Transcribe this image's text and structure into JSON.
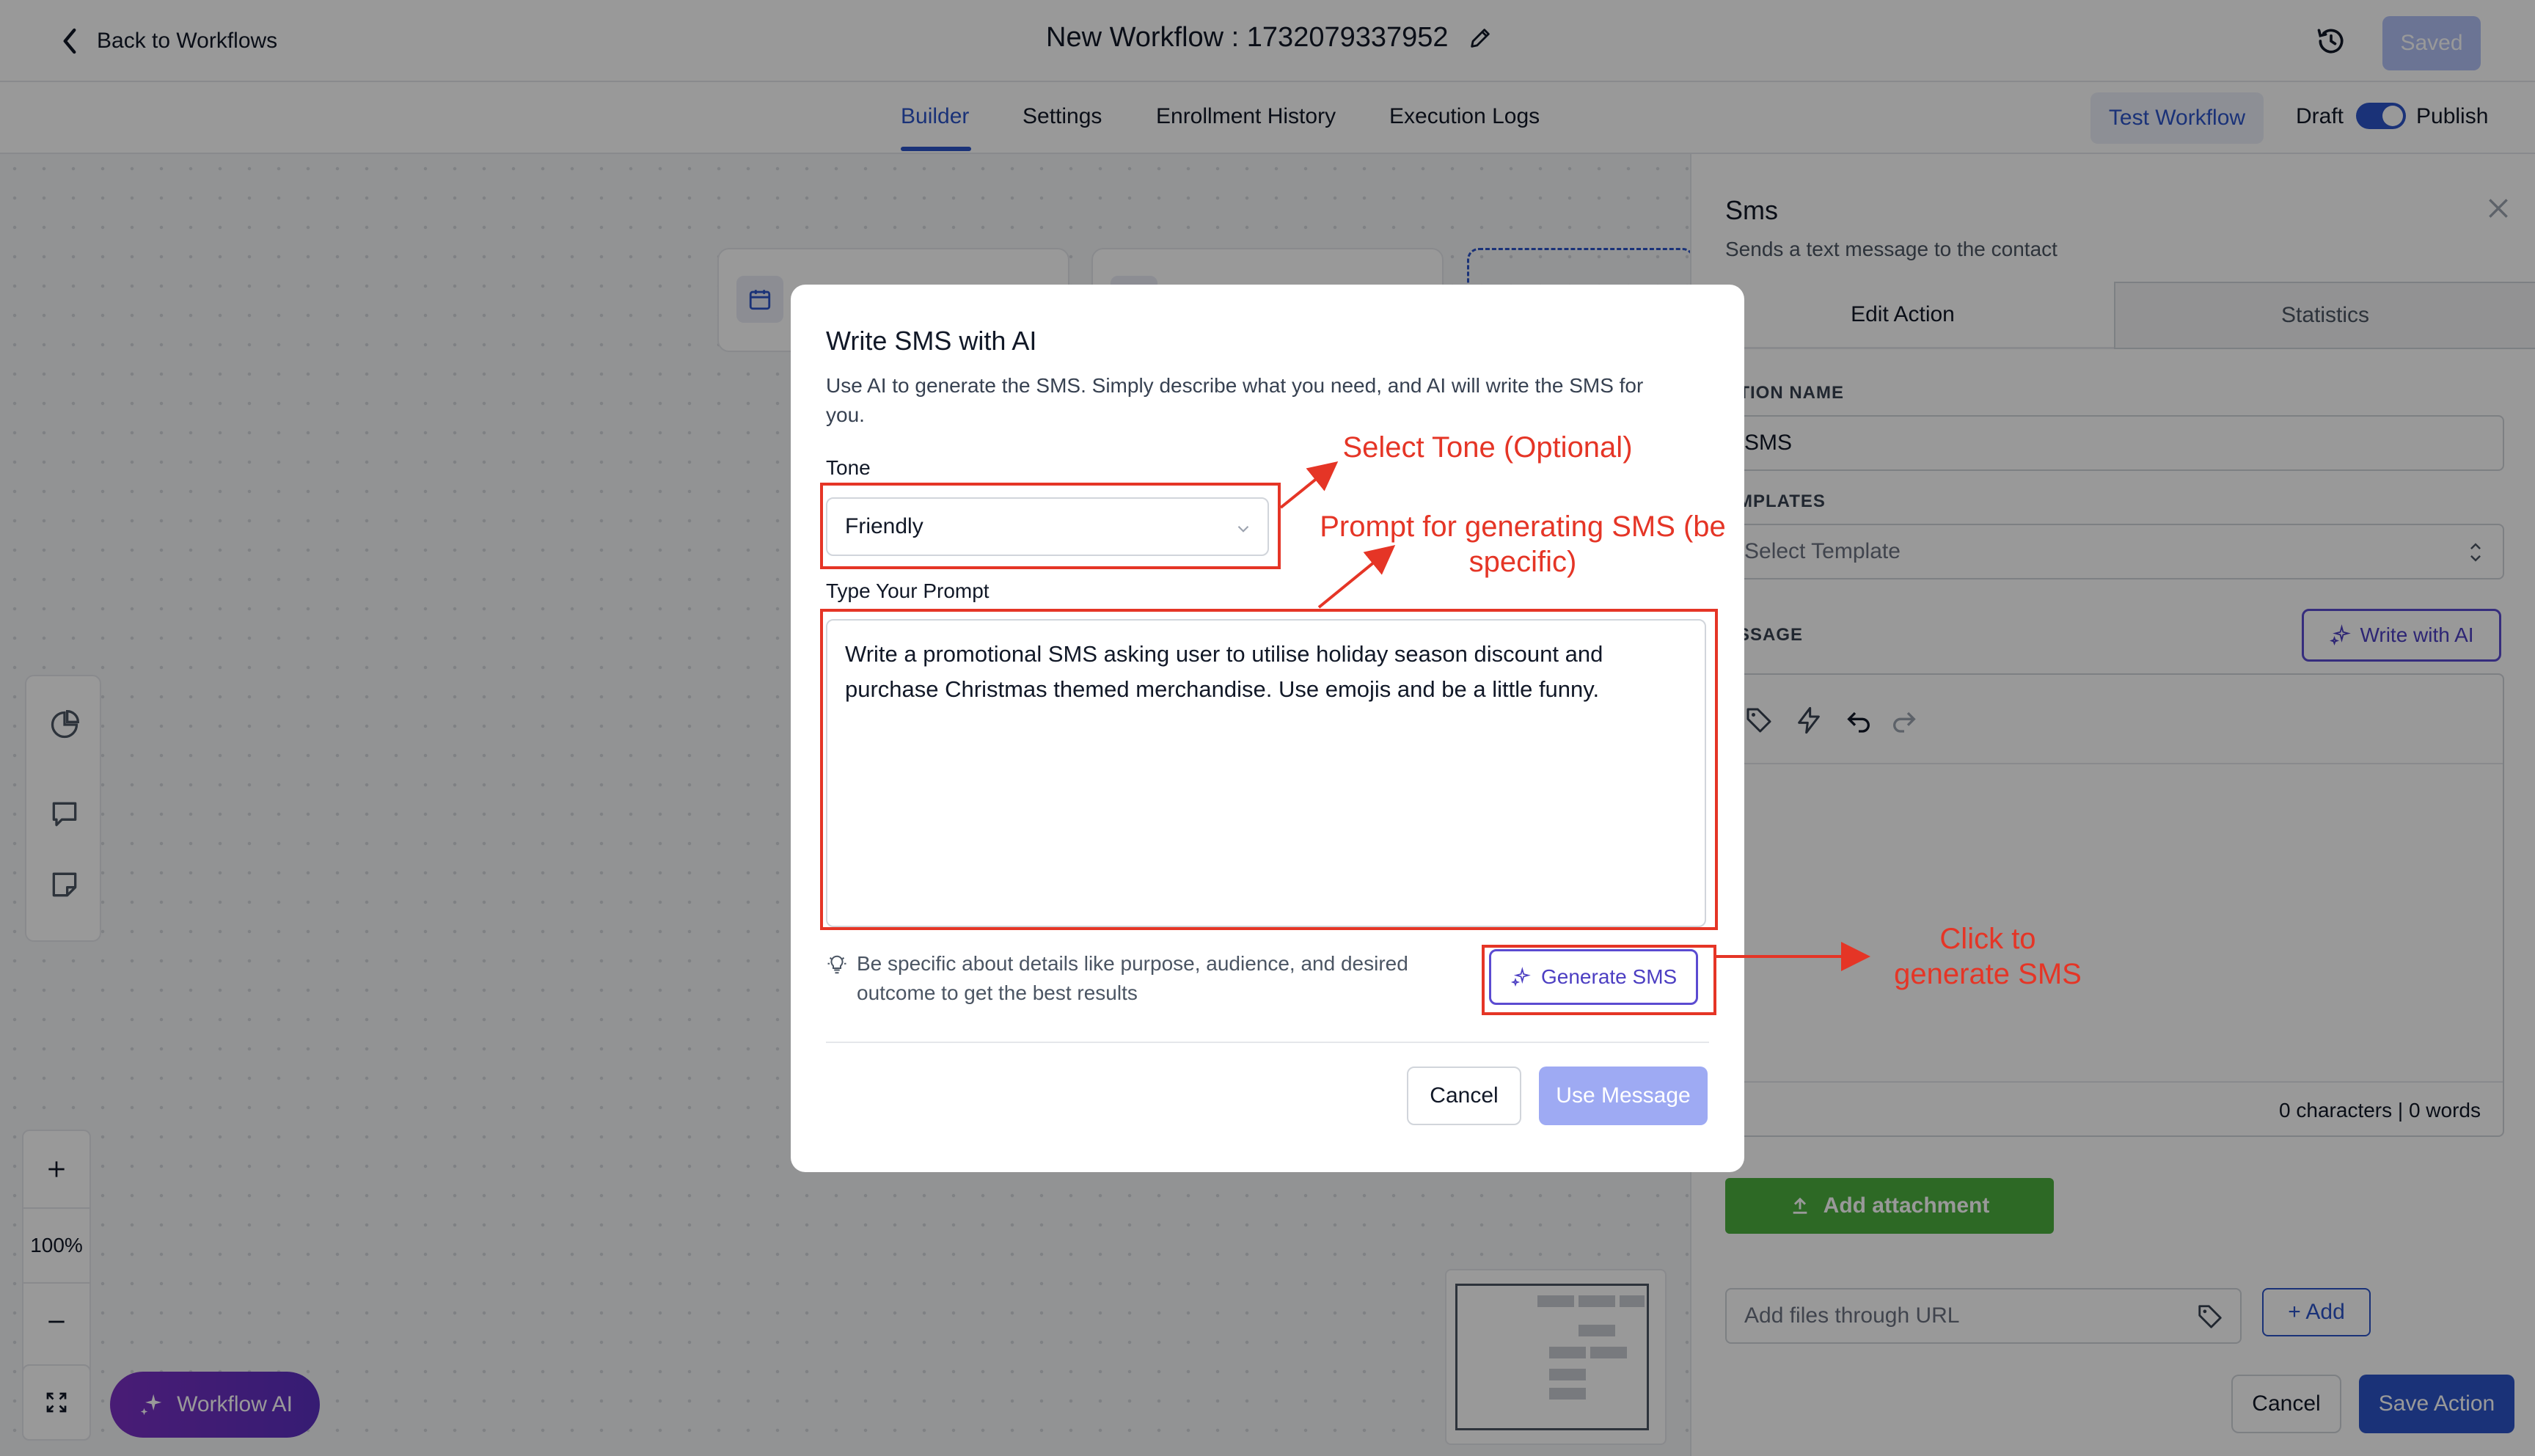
{
  "header": {
    "back_label": "Back to Workflows",
    "title": "New Workflow : 1732079337952",
    "saved_label": "Saved"
  },
  "tabs": {
    "items": [
      {
        "label": "Builder",
        "active": true
      },
      {
        "label": "Settings",
        "active": false
      },
      {
        "label": "Enrollment History",
        "active": false
      },
      {
        "label": "Execution Logs",
        "active": false
      }
    ],
    "test_workflow": "Test Workflow",
    "draft": "Draft",
    "publish": "Publish",
    "publish_on": true
  },
  "canvas": {
    "zoom_level": "100%",
    "workflow_ai": "Workflow AI"
  },
  "panel": {
    "title": "Sms",
    "subtitle": "Sends a text message to the contact",
    "tab_edit": "Edit Action",
    "tab_stats": "Statistics",
    "action_name_label": "CTION NAME",
    "action_name_value": "SMS",
    "templates_label": "EMPLATES",
    "templates_placeholder": "Select Template",
    "message_label": "ESSAGE",
    "write_with_ai": "Write with AI",
    "counts": "0 characters | 0 words",
    "add_attachment": "Add attachment",
    "url_placeholder": "Add files through URL",
    "add": "+ Add",
    "cancel": "Cancel",
    "save_action": "Save Action"
  },
  "modal": {
    "title": "Write SMS with AI",
    "description": "Use AI to generate the SMS. Simply describe what you need, and AI will write the SMS for you.",
    "tone_label": "Tone",
    "tone_value": "Friendly",
    "prompt_label": "Type Your Prompt",
    "prompt_value": "Write a promotional SMS asking user to utilise holiday season discount and purchase Christmas themed merchandise. Use emojis and be a little funny.",
    "tip": "Be specific about details like purpose, audience, and desired outcome to get the best results",
    "generate": "Generate SMS",
    "cancel": "Cancel",
    "use_message": "Use Message"
  },
  "annotations": {
    "tone": "Select Tone (Optional)",
    "prompt_line1": "Prompt for generating SMS (be",
    "prompt_line2": "specific)",
    "click_line1": "Click to",
    "click_line2": "generate SMS",
    "color": "#e53526"
  },
  "colors": {
    "accent": "#2c54c8",
    "ai_purple": "#5b4bd1",
    "attach_green": "#4caf3f"
  }
}
